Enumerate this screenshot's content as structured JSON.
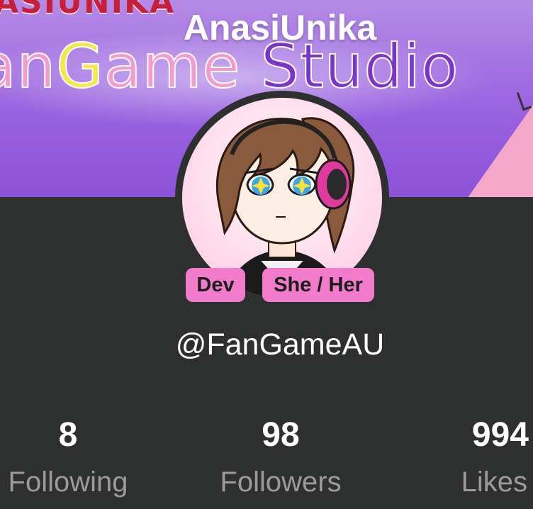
{
  "banner": {
    "top_text": "ASIUNIKA",
    "studio_parts": [
      "an",
      "G",
      "ame",
      " Studio"
    ]
  },
  "profile": {
    "name": "AnasiUnika",
    "handle": "@FanGameAU",
    "badges": [
      "Dev",
      "She / Her"
    ]
  },
  "stats": {
    "following": {
      "value": "8",
      "label": "Following"
    },
    "followers": {
      "value": "98",
      "label": "Followers"
    },
    "likes": {
      "value": "994",
      "label": "Likes"
    }
  },
  "colors": {
    "background": "#2e2f2f",
    "badge": "#f27ccb",
    "stat_label": "#9b9b9b",
    "banner": "#9a63e0"
  }
}
